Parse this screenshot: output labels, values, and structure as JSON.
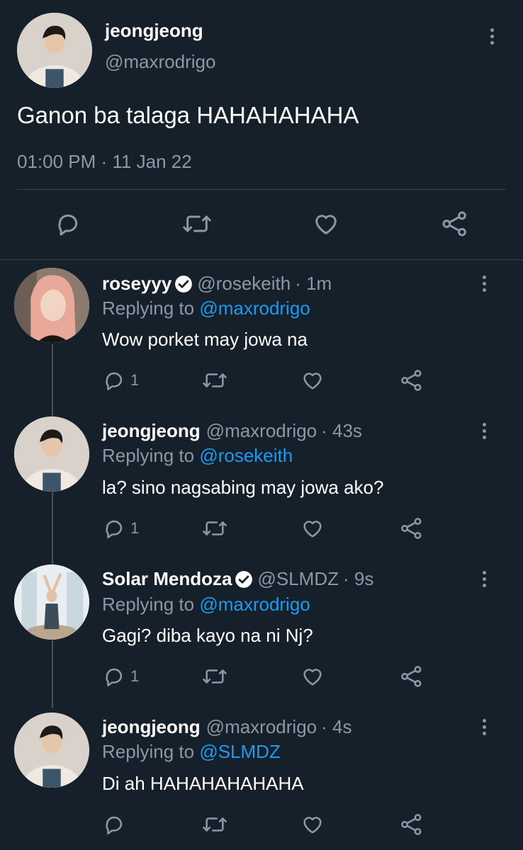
{
  "main_tweet": {
    "display_name": "jeongjeong",
    "handle": "@maxrodrigo",
    "text": "Ganon ba talaga HAHAHAHAHA",
    "timestamp": "01:00 PM · 11 Jan 22"
  },
  "replies": [
    {
      "display_name": "roseyyy",
      "verified": true,
      "handle": "@rosekeith",
      "time": "· 1m",
      "replying_label": "Replying to",
      "replying_to": "@maxrodrigo",
      "text": "Wow porket may jowa na",
      "reply_count": "1"
    },
    {
      "display_name": "jeongjeong",
      "verified": false,
      "handle": "@maxrodrigo",
      "time": "· 43s",
      "replying_label": "Replying to",
      "replying_to": "@rosekeith",
      "text": "la? sino nagsabing may jowa ako?",
      "reply_count": "1"
    },
    {
      "display_name": "Solar Mendoza",
      "verified": true,
      "handle": "@SLMDZ",
      "time": "· 9s",
      "replying_label": "Replying to",
      "replying_to": "@maxrodrigo",
      "text": "Gagi? diba kayo na ni Nj?",
      "reply_count": "1"
    },
    {
      "display_name": "jeongjeong",
      "verified": false,
      "handle": "@maxrodrigo",
      "time": "· 4s",
      "replying_label": "Replying to",
      "replying_to": "@SLMDZ",
      "text": "Di ah HAHAHAHAHAHA",
      "reply_count": ""
    }
  ],
  "colors": {
    "background": "#15202b",
    "muted": "#8b98a5",
    "link": "#1d9bf0",
    "divider": "#38444d"
  },
  "icons": [
    "reply-icon",
    "retweet-icon",
    "like-icon",
    "share-icon",
    "more-icon",
    "verified-icon"
  ]
}
